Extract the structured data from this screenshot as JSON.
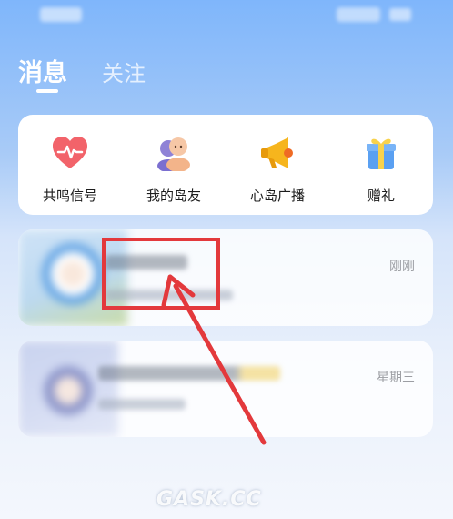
{
  "tabs": {
    "messages": "消息",
    "follow": "关注"
  },
  "quick_actions": [
    {
      "label": "共鸣信号",
      "icon": "heart-pulse-icon"
    },
    {
      "label": "我的岛友",
      "icon": "friends-icon"
    },
    {
      "label": "心岛广播",
      "icon": "megaphone-icon"
    },
    {
      "label": "赠礼",
      "icon": "gift-icon"
    }
  ],
  "messages": [
    {
      "time": "刚刚"
    },
    {
      "time": "星期三"
    }
  ],
  "colors": {
    "accent": "#e3393c",
    "card_background": "#ffffff",
    "time_text": "#9c9ea3"
  },
  "watermark": "GASK.CC"
}
